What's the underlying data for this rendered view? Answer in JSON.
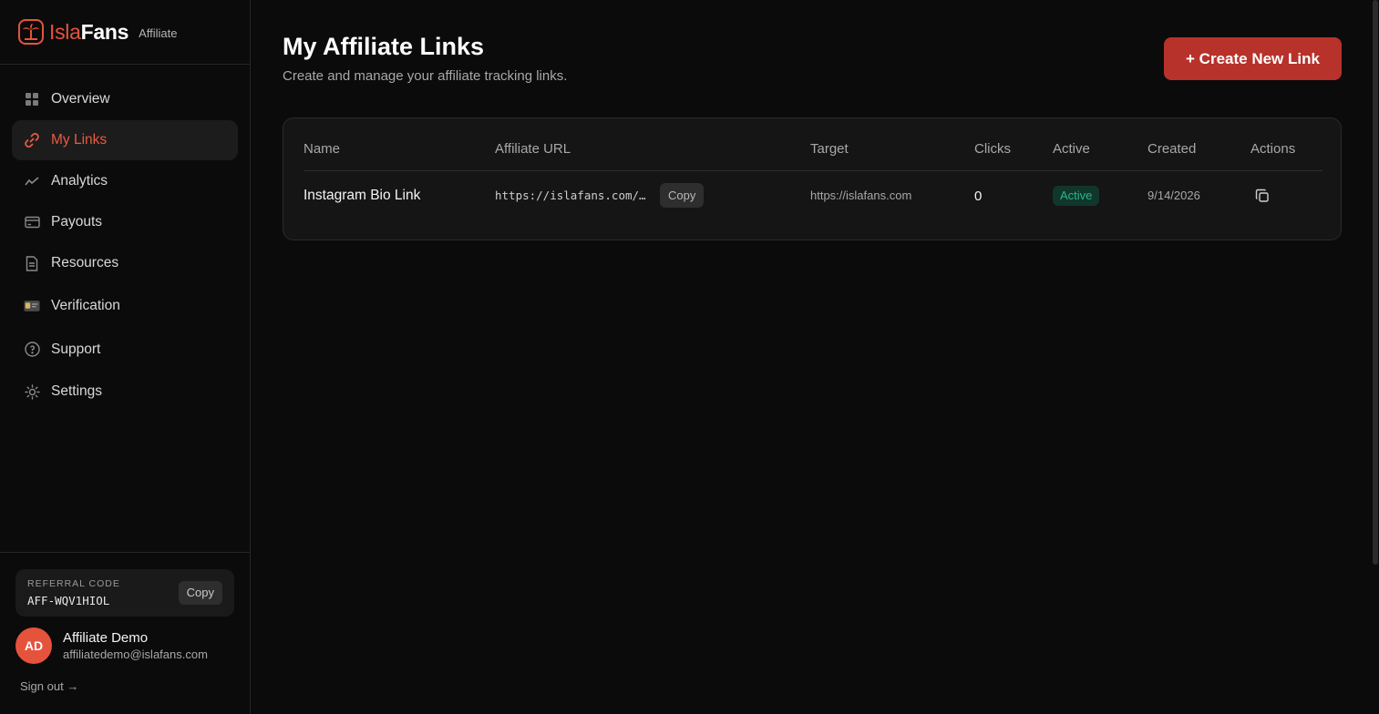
{
  "brand": {
    "name_part1": "Isla",
    "name_part2": "Fans",
    "tag": "Affiliate",
    "accent": "#e5533d"
  },
  "sidebar": {
    "items": [
      {
        "label": "Overview",
        "icon": "grid-icon"
      },
      {
        "label": "My Links",
        "icon": "link-icon",
        "active": true
      },
      {
        "label": "Analytics",
        "icon": "trend-icon"
      },
      {
        "label": "Payouts",
        "icon": "card-icon"
      },
      {
        "label": "Resources",
        "icon": "document-icon"
      },
      {
        "label": "Verification",
        "icon": "id-card-icon"
      },
      {
        "label": "Support",
        "icon": "help-circle-icon"
      },
      {
        "label": "Settings",
        "icon": "gear-icon"
      }
    ],
    "referral": {
      "label": "REFERRAL CODE",
      "code": "AFF-WQV1HIOL",
      "copy_label": "Copy"
    },
    "user": {
      "initials": "AD",
      "name": "Affiliate Demo",
      "email": "affiliatedemo@islafans.com"
    },
    "signout": "Sign out →"
  },
  "header": {
    "title": "My Affiliate Links",
    "subtitle": "Create and manage your affiliate tracking links.",
    "create_button": "+ Create New Link"
  },
  "table": {
    "columns": [
      "Name",
      "Affiliate URL",
      "Target",
      "Clicks",
      "Active",
      "Created",
      "Actions"
    ],
    "rows": [
      {
        "name": "Instagram Bio Link",
        "url": "https://islafans.com/…",
        "copy_label": "Copy",
        "target": "https://islafans.com",
        "clicks": "0",
        "active": "Active",
        "created": "9/14/2026"
      }
    ]
  },
  "colors": {
    "primary_button": "#b7322a",
    "active_badge_bg": "#11362c",
    "active_badge_text": "#29b888"
  }
}
